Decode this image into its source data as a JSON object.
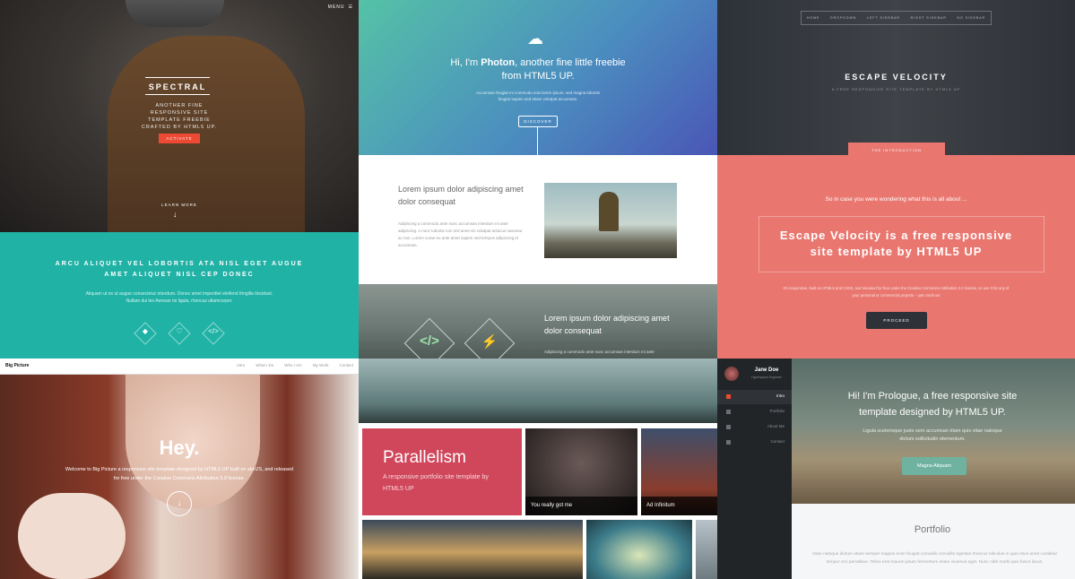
{
  "spectral": {
    "menu": "MENU",
    "title": "SPECTRAL",
    "subtitle": "ANOTHER FINE RESPONSIVE SITE TEMPLATE FREEBIE CRAFTED BY HTML5 UP.",
    "button": "ACTIVATE",
    "learn_more": "LEARN MORE",
    "teal_heading": "ARCU ALIQUET VEL LOBORTIS ATA NISL EGET AUGUE AMET ALIQUET NISL CEP DONEC",
    "teal_text": "Aliquam ut ex ut augue consectetur interdum. Donec amet imperdiet eleifend fringilla tincidunt. Nullam dui leo Aenean mi ligula, rhoncus ullamcorper.",
    "accent": "#21b2a6",
    "button_color": "#ed4933",
    "icons": [
      "diamond-icon",
      "heart-icon",
      "code-icon"
    ]
  },
  "photon": {
    "heading_pre": "Hi, I'm ",
    "heading_bold": "Photon",
    "heading_post": ", another fine little freebie from HTML5 UP.",
    "hero_text": "Accumsan feugiat mi commodo erat lorem ipsum, sed magna lobortis feugiat sapien sed etiam volutpat accumsan.",
    "button": "DISCOVER",
    "section_heading": "Lorem ipsum dolor adipiscing amet dolor consequat",
    "section_text": "Adipiscing a commodo ante nunc accumsan interdum mi ante adipiscing. A nunc lobortis non nisl amet vis volutpat aclacus nascetur ac non. Lorem curae eu ante amet sapien sed tempus adipiscing id accumsan.",
    "mountain_heading": "Lorem ipsum dolor adipiscing amet dolor consequat",
    "mountain_text": "Adipiscing a commodo ante nunc accumsan interdum mi ante",
    "icons": [
      "code-icon",
      "bolt-icon"
    ]
  },
  "escape": {
    "nav": [
      "HOME",
      "DROPDOWN",
      "LEFT SIDEBAR",
      "RIGHT SIDEBAR",
      "NO SIDEBAR"
    ],
    "title": "ESCAPE VELOCITY",
    "tagline": "A FREE RESPONSIVE SITE TEMPLATE BY HTML5 UP",
    "intro_tab": "THE INTRODUCTION",
    "wonder": "So in case you were wondering what this is all about ...",
    "big": "Escape Velocity is a free responsive site template by HTML5 UP",
    "small": "It's responsive, built on HTML5 and CSS3, and released for free under the Creative Commons Attribution 3.0 license, so use it for any of your personal or commercial projects – just credit us!",
    "button": "PROCEED",
    "accent": "#e97770"
  },
  "bigpicture": {
    "brand": "Big Picture",
    "links": [
      "Intro",
      "What I Do",
      "Who I Am",
      "My Work",
      "Contact"
    ],
    "hey": "Hey.",
    "text": "Welcome to Big Picture a responsive site template designed by HTML5 UP built on skelJS, and released for free under the Creative Commons Attribution 3.0 license."
  },
  "parallelism": {
    "title": "Parallelism",
    "text": "A responsive portfolio site template by HTML5 UP",
    "captions": [
      "You really got me",
      "Ad Infinitum"
    ],
    "accent": "#d0465b"
  },
  "prologue": {
    "name": "Jane Doe",
    "role": "Hyperspace Engineer",
    "nav": [
      "Intro",
      "Portfolio",
      "About Me",
      "Contact"
    ],
    "heading": "Hi! I'm Prologue, a free responsive site template designed by HTML5 UP.",
    "hero_text": "Ligula scelerisque justo sem accumsan diam quis vitae natoque dictum sollicitudin elementum.",
    "button": "Magna Aliquam",
    "section_title": "Portfolio",
    "section_text": "Vitae natoque dictum etiam semper magnis enim feugiat convallis convallis egestas rhoncus ridiculus in quis risus amet curabitur tempor orci penatibus. Tellus erat mauris ipsum fermentum etiam vivamus eget. Nunc nibh morbi quis fusce lacus."
  }
}
